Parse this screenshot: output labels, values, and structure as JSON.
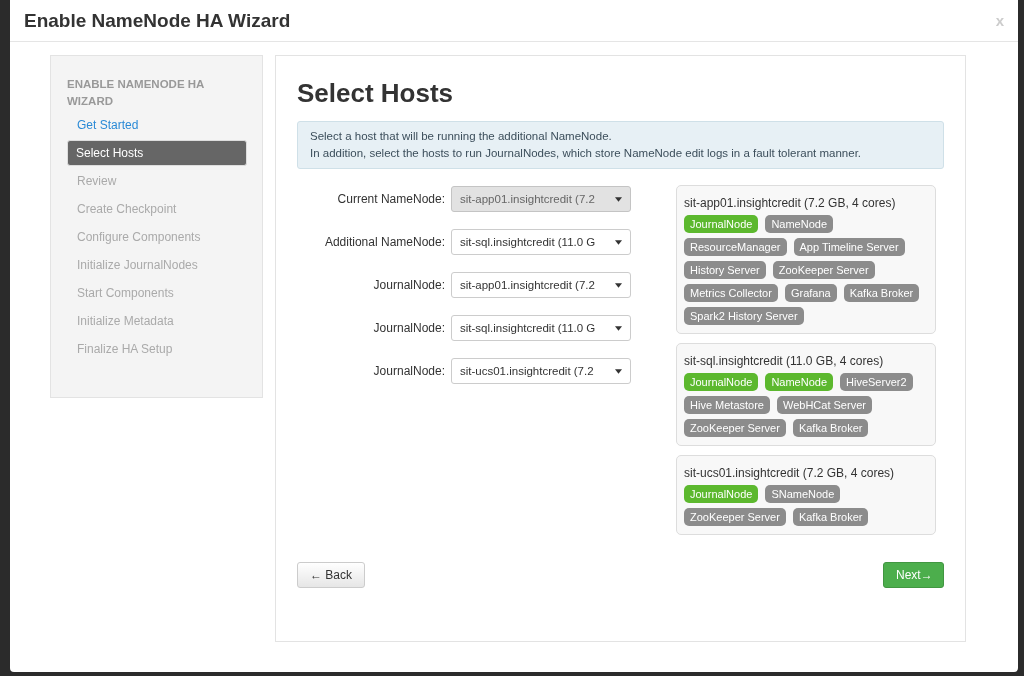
{
  "window": {
    "title": "Enable NameNode HA Wizard",
    "close": "x"
  },
  "sidebar": {
    "heading": "ENABLE NAMENODE HA WIZARD",
    "items": [
      {
        "label": "Get Started",
        "selected": false,
        "disabled": false
      },
      {
        "label": "Select Hosts",
        "selected": true,
        "disabled": false
      },
      {
        "label": "Review",
        "selected": false,
        "disabled": true
      },
      {
        "label": "Create Checkpoint",
        "selected": false,
        "disabled": true
      },
      {
        "label": "Configure Components",
        "selected": false,
        "disabled": true
      },
      {
        "label": "Initialize JournalNodes",
        "selected": false,
        "disabled": true
      },
      {
        "label": "Start Components",
        "selected": false,
        "disabled": true
      },
      {
        "label": "Initialize Metadata",
        "selected": false,
        "disabled": true
      },
      {
        "label": "Finalize HA Setup",
        "selected": false,
        "disabled": true
      }
    ]
  },
  "main": {
    "title": "Select Hosts",
    "info": [
      "Select a host that will be running the additional NameNode.",
      "In addition, select the hosts to run JournalNodes, which store NameNode edit logs in a fault tolerant manner."
    ],
    "fields": [
      {
        "label": "Current NameNode:",
        "value": "sit-app01.insightcredit (7.2",
        "disabled": true
      },
      {
        "label": "Additional NameNode:",
        "value": "sit-sql.insightcredit (11.0 G",
        "disabled": false
      },
      {
        "label": "JournalNode:",
        "value": "sit-app01.insightcredit (7.2",
        "disabled": false
      },
      {
        "label": "JournalNode:",
        "value": "sit-sql.insightcredit (11.0 G",
        "disabled": false
      },
      {
        "label": "JournalNode:",
        "value": "sit-ucs01.insightcredit (7.2",
        "disabled": false
      }
    ],
    "hosts": [
      {
        "name": "sit-app01.insightcredit (7.2 GB, 4 cores)",
        "components": [
          {
            "label": "JournalNode",
            "highlighted": true
          },
          {
            "label": "NameNode",
            "highlighted": false
          },
          {
            "label": "ResourceManager",
            "highlighted": false
          },
          {
            "label": "App Timeline Server",
            "highlighted": false
          },
          {
            "label": "History Server",
            "highlighted": false
          },
          {
            "label": "ZooKeeper Server",
            "highlighted": false
          },
          {
            "label": "Metrics Collector",
            "highlighted": false
          },
          {
            "label": "Grafana",
            "highlighted": false
          },
          {
            "label": "Kafka Broker",
            "highlighted": false
          },
          {
            "label": "Spark2 History Server",
            "highlighted": false
          }
        ]
      },
      {
        "name": "sit-sql.insightcredit (11.0 GB, 4 cores)",
        "components": [
          {
            "label": "JournalNode",
            "highlighted": true
          },
          {
            "label": "NameNode",
            "highlighted": true
          },
          {
            "label": "HiveServer2",
            "highlighted": false
          },
          {
            "label": "Hive Metastore",
            "highlighted": false
          },
          {
            "label": "WebHCat Server",
            "highlighted": false
          },
          {
            "label": "ZooKeeper Server",
            "highlighted": false
          },
          {
            "label": "Kafka Broker",
            "highlighted": false
          }
        ]
      },
      {
        "name": "sit-ucs01.insightcredit (7.2 GB, 4 cores)",
        "components": [
          {
            "label": "JournalNode",
            "highlighted": true
          },
          {
            "label": "SNameNode",
            "highlighted": false
          },
          {
            "label": "ZooKeeper Server",
            "highlighted": false
          },
          {
            "label": "Kafka Broker",
            "highlighted": false
          }
        ]
      }
    ],
    "back": "← Back",
    "next": "Next→"
  }
}
